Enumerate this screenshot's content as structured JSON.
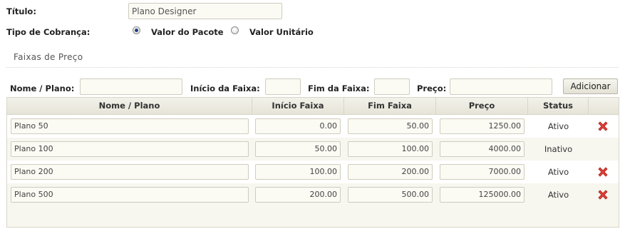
{
  "form": {
    "titulo_label": "Título:",
    "titulo_value": "Plano Designer",
    "tipo_label": "Tipo de Cobrança:",
    "options": [
      "Valor do Pacote",
      "Valor Unitário"
    ],
    "selected": "Valor do Pacote"
  },
  "section": {
    "title": "Faixas de Preço"
  },
  "filter": {
    "nome_label": "Nome / Plano:",
    "inicio_label": "Início da Faixa:",
    "fim_label": "Fim da Faixa:",
    "preco_label": "Preço:",
    "add_button": "Adicionar"
  },
  "table": {
    "columns": [
      "Nome / Plano",
      "Início Faixa",
      "Fim Faixa",
      "Preço",
      "Status",
      ""
    ],
    "rows": [
      {
        "nome": "Plano 50",
        "inicio": "0.00",
        "fim": "50.00",
        "preco": "1250.00",
        "status": "Ativo",
        "deletable": true
      },
      {
        "nome": "Plano 100",
        "inicio": "50.00",
        "fim": "100.00",
        "preco": "4000.00",
        "status": "Inativo",
        "deletable": false
      },
      {
        "nome": "Plano 200",
        "inicio": "100.00",
        "fim": "200.00",
        "preco": "7000.00",
        "status": "Ativo",
        "deletable": true
      },
      {
        "nome": "Plano 500",
        "inicio": "200.00",
        "fim": "500.00",
        "preco": "125000.00",
        "status": "Ativo",
        "deletable": true
      }
    ]
  },
  "icons": {
    "delete": "delete-x-icon",
    "delete_color": "#d9332b"
  }
}
